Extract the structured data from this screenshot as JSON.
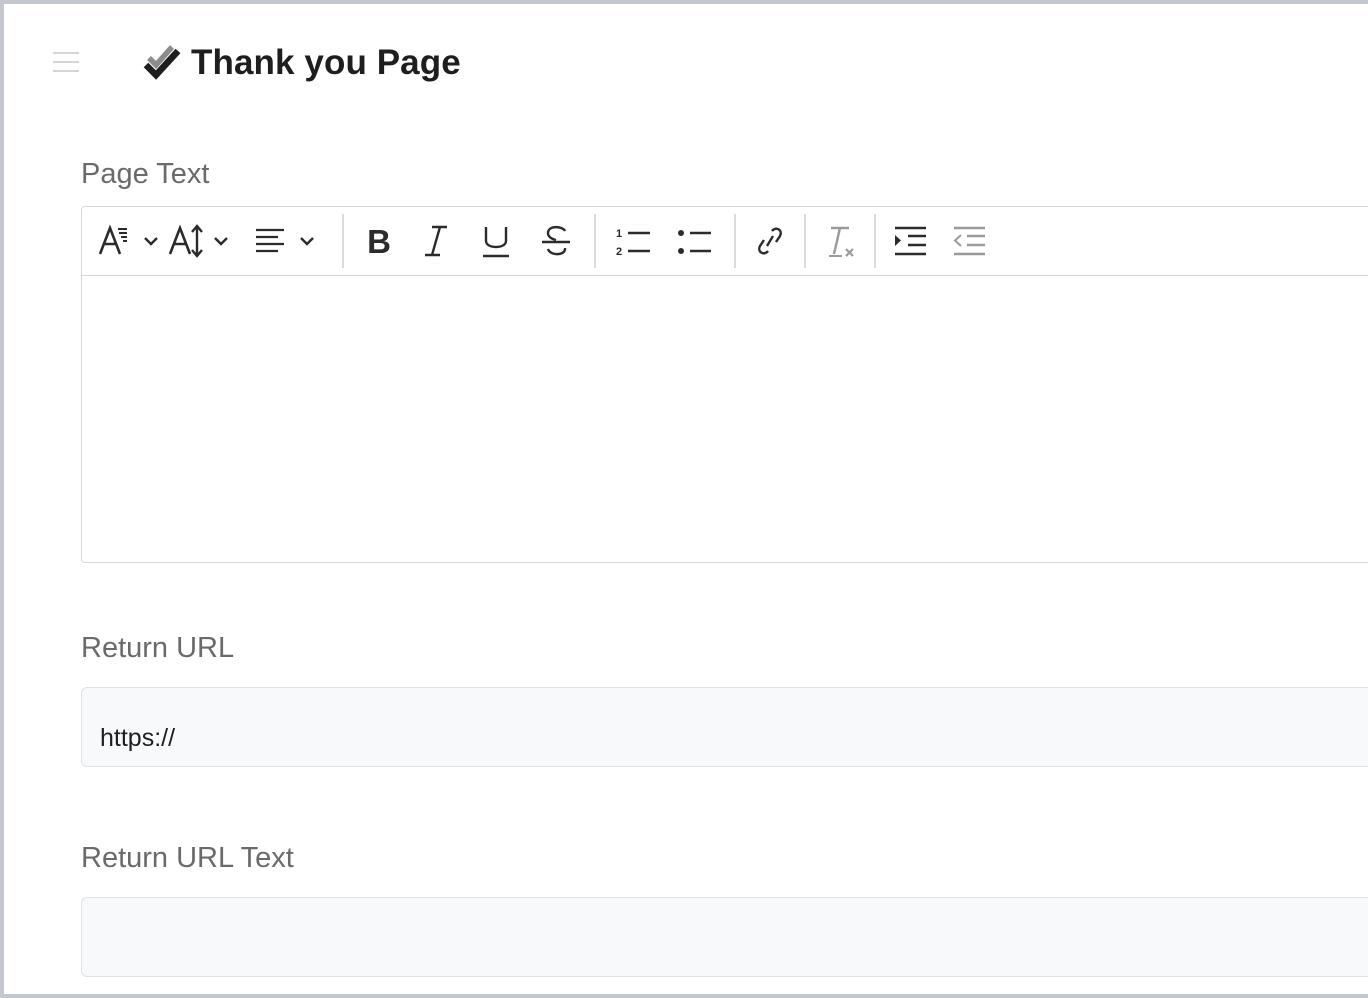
{
  "header": {
    "title": "Thank you Page",
    "menu_icon": "hamburger-menu-icon",
    "title_icon": "double-check-icon"
  },
  "form": {
    "page_text": {
      "label": "Page Text",
      "toolbar": [
        "font-style-icon",
        "font-size-icon",
        "text-align-icon",
        "bold-icon",
        "italic-icon",
        "underline-icon",
        "strikethrough-icon",
        "ordered-list-icon",
        "unordered-list-icon",
        "link-icon",
        "clear-formatting-icon",
        "indent-icon",
        "outdent-icon"
      ],
      "content": ""
    },
    "return_url": {
      "label": "Return URL",
      "value": "https://"
    },
    "return_url_text": {
      "label": "Return URL Text",
      "value": ""
    }
  },
  "colors": {
    "icon": "#2b2b2b",
    "icon_disabled": "#9a9a9a",
    "label": "#6a6a6a",
    "input_bg": "#f8f9fb",
    "border": "#d5d9de"
  }
}
